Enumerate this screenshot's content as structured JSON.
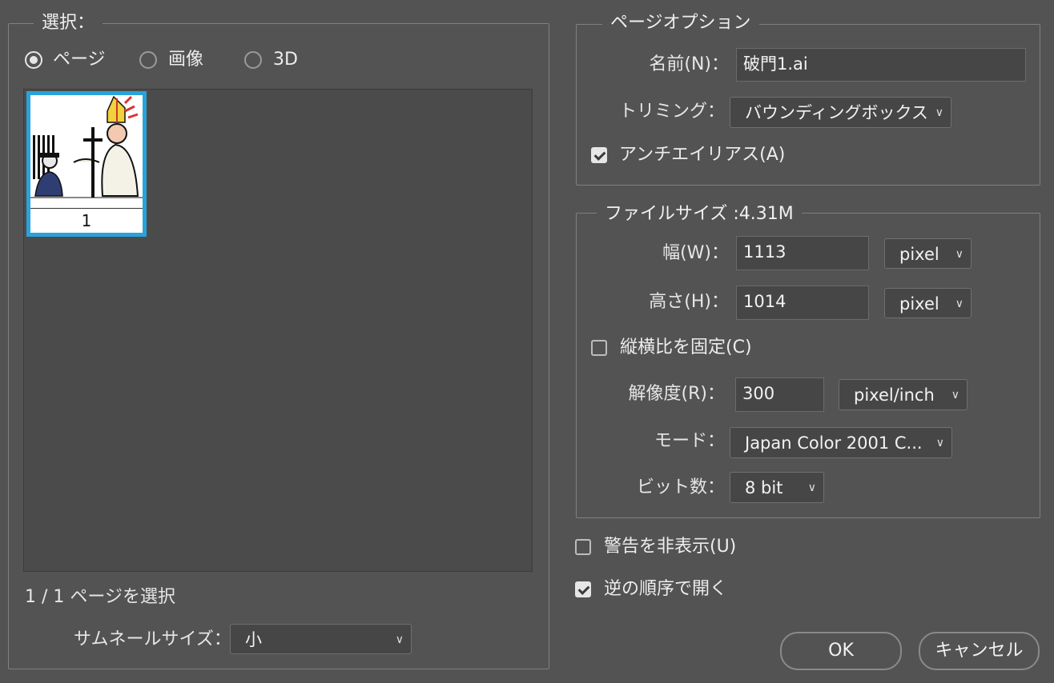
{
  "selection": {
    "legend": "選択：",
    "radios": [
      {
        "label": "ページ",
        "selected": true
      },
      {
        "label": "画像",
        "selected": false
      },
      {
        "label": "3D",
        "selected": false
      }
    ],
    "thumbnail_page_number": "1",
    "status": "1 / 1 ページを選択",
    "thumbnail_size_label": "サムネールサイズ：",
    "thumbnail_size_value": "小"
  },
  "page_options": {
    "legend": "ページオプション",
    "name_label": "名前(N)：",
    "name_value": "破門1.ai",
    "crop_label": "トリミング：",
    "crop_value": "バウンディングボックス",
    "antialias_label": "アンチエイリアス(A)",
    "antialias_checked": true
  },
  "image_size": {
    "legend": "ファイルサイズ :4.31M",
    "width_label": "幅(W)：",
    "width_value": "1113",
    "width_unit": "pixel",
    "height_label": "高さ(H)：",
    "height_value": "1014",
    "height_unit": "pixel",
    "constrain_label": "縦横比を固定(C)",
    "constrain_checked": false,
    "resolution_label": "解像度(R)：",
    "resolution_value": "300",
    "resolution_unit": "pixel/inch",
    "mode_label": "モード：",
    "mode_value": "Japan Color 2001 C...",
    "depth_label": "ビット数：",
    "depth_value": "8 bit"
  },
  "options": {
    "suppress_warnings_label": "警告を非表示(U)",
    "suppress_warnings_checked": false,
    "reverse_order_label": "逆の順序で開く",
    "reverse_order_checked": true
  },
  "buttons": {
    "ok": "OK",
    "cancel": "キャンセル"
  },
  "colors": {
    "background": "#535353",
    "selection_highlight": "#29a3dc"
  }
}
